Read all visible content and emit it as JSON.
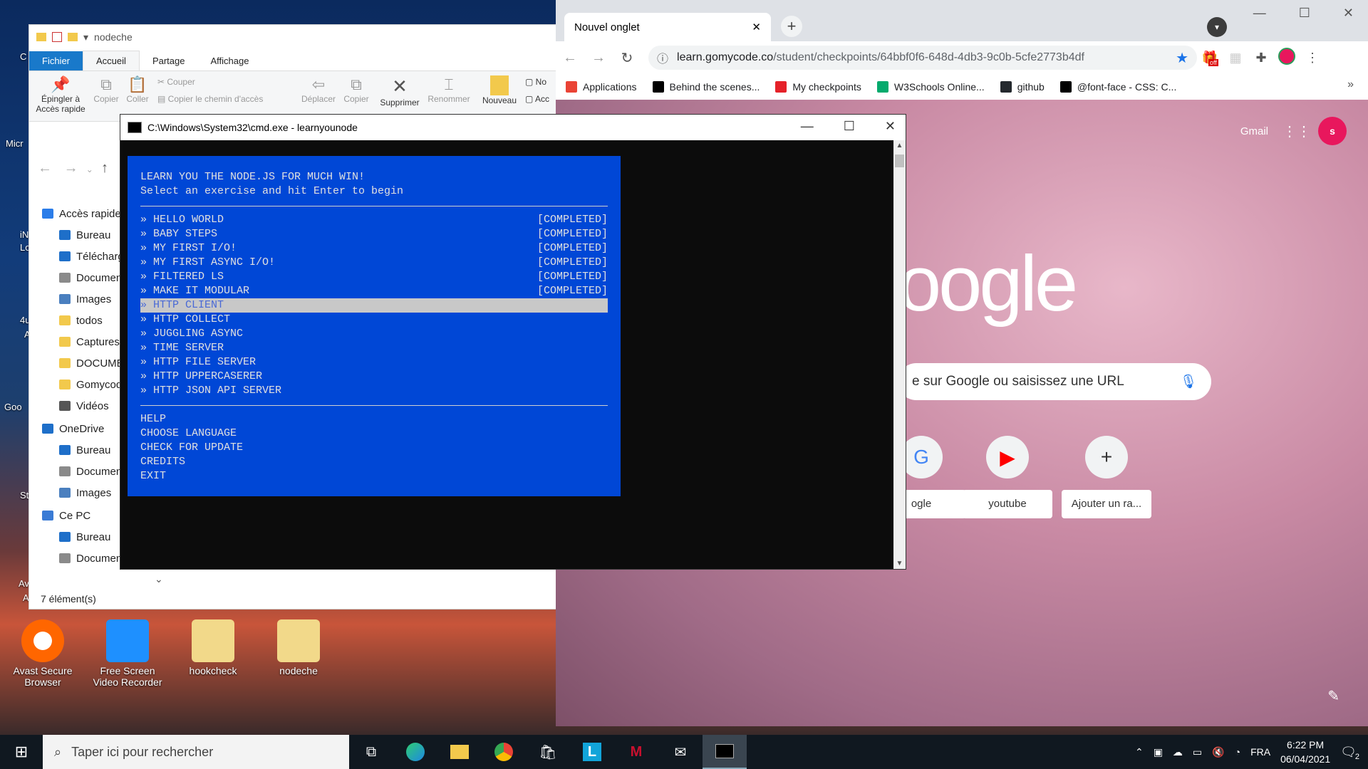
{
  "desktop": {
    "icons": [
      {
        "label": "Avast Secure Browser"
      },
      {
        "label": "Free Screen Video Recorder"
      },
      {
        "label": "hookcheck"
      },
      {
        "label": "nodeche"
      }
    ],
    "edge_labels": [
      "C",
      "Micr",
      "iN",
      "Lo",
      "4u",
      "A",
      "Goo",
      "St",
      "Av",
      "A"
    ]
  },
  "explorer": {
    "title": "nodeche",
    "tabs": [
      "Fichier",
      "Accueil",
      "Partage",
      "Affichage"
    ],
    "ribbon": {
      "pin_label": "Épingler à Accès rapide",
      "copy": "Copier",
      "paste": "Coller",
      "cut": "Couper",
      "copy_path": "Copier le chemin d'accès",
      "move": "Déplacer",
      "copy_to": "Copier",
      "delete": "Supprimer",
      "rename": "Renommer",
      "new": "Nouveau",
      "new_item_short": "No",
      "easy_access_short": "Acc"
    },
    "nav": [
      {
        "label": "Accès rapide",
        "level": 0,
        "icon": "star-icon",
        "color": "#2b7de9"
      },
      {
        "label": "Bureau",
        "level": 1,
        "icon": "desktop-icon",
        "color": "#1e6fc9"
      },
      {
        "label": "Téléchargements",
        "level": 1,
        "icon": "download-icon",
        "color": "#1e6fc9"
      },
      {
        "label": "Documents",
        "level": 1,
        "icon": "document-icon",
        "color": "#8a8a8a"
      },
      {
        "label": "Images",
        "level": 1,
        "icon": "images-icon",
        "color": "#4a7fbf"
      },
      {
        "label": "todos",
        "level": 1,
        "icon": "folder-icon",
        "color": "#f2c94c"
      },
      {
        "label": "Captures",
        "level": 1,
        "icon": "folder-icon",
        "color": "#f2c94c"
      },
      {
        "label": "DOCUMENTS",
        "level": 1,
        "icon": "folder-icon",
        "color": "#f2c94c"
      },
      {
        "label": "Gomycode",
        "level": 1,
        "icon": "folder-icon",
        "color": "#f2c94c"
      },
      {
        "label": "Vidéos",
        "level": 1,
        "icon": "video-icon",
        "color": "#555555"
      },
      {
        "label": "OneDrive",
        "level": 0,
        "icon": "cloud-icon",
        "color": "#1e6fc9"
      },
      {
        "label": "Bureau",
        "level": 1,
        "icon": "desktop-icon",
        "color": "#1e6fc9"
      },
      {
        "label": "Documents",
        "level": 1,
        "icon": "document-icon",
        "color": "#8a8a8a"
      },
      {
        "label": "Images",
        "level": 1,
        "icon": "images-icon",
        "color": "#4a7fbf"
      },
      {
        "label": "Ce PC",
        "level": 0,
        "icon": "computer-icon",
        "color": "#3a7bd5"
      },
      {
        "label": "Bureau",
        "level": 1,
        "icon": "desktop-icon",
        "color": "#1e6fc9"
      },
      {
        "label": "Documents",
        "level": 1,
        "icon": "document-icon",
        "color": "#8a8a8a"
      }
    ],
    "status": "7 élément(s)"
  },
  "chrome": {
    "tab_title": "Nouvel onglet",
    "url_host": "learn.gomycode.co",
    "url_path": "/student/checkpoints/64bbf0f6-648d-4db3-9c0b-5cfe2773b4df",
    "bookmarks": [
      {
        "label": "Applications",
        "icon": "apps-icon",
        "color": "#ea4335"
      },
      {
        "label": "Behind the scenes...",
        "icon": "dev-icon",
        "color": "#000000"
      },
      {
        "label": "My checkpoints",
        "icon": "gomycode-icon",
        "color": "#e52129"
      },
      {
        "label": "W3Schools Online...",
        "icon": "w3schools-icon",
        "color": "#04aa6d"
      },
      {
        "label": "github",
        "icon": "github-icon",
        "color": "#24292e"
      },
      {
        "label": "@font-face - CSS: C...",
        "icon": "mdn-icon",
        "color": "#000000"
      }
    ],
    "gmail": "Gmail",
    "profile_initial": "s",
    "logo_text": "oogle",
    "search_placeholder": "e sur Google ou saisissez une URL",
    "shortcuts": [
      {
        "label": "ogle",
        "glyph": "G"
      },
      {
        "label": "youtube",
        "glyph": "▶"
      },
      {
        "label": "Ajouter un ra...",
        "glyph": "+"
      }
    ],
    "ext_badge": "off"
  },
  "cmd": {
    "title": "C:\\Windows\\System32\\cmd.exe - learnyounode",
    "header_line1": "LEARN YOU THE NODE.JS FOR MUCH WIN!",
    "header_line2": "Select an exercise and hit Enter to begin",
    "exercises": [
      {
        "name": "» HELLO WORLD",
        "status": "[COMPLETED]",
        "selected": false
      },
      {
        "name": "» BABY STEPS",
        "status": "[COMPLETED]",
        "selected": false
      },
      {
        "name": "» MY FIRST I/O!",
        "status": "[COMPLETED]",
        "selected": false
      },
      {
        "name": "» MY FIRST ASYNC I/O!",
        "status": "[COMPLETED]",
        "selected": false
      },
      {
        "name": "» FILTERED LS",
        "status": "[COMPLETED]",
        "selected": false
      },
      {
        "name": "» MAKE IT MODULAR",
        "status": "[COMPLETED]",
        "selected": false
      },
      {
        "name": "» HTTP CLIENT",
        "status": "",
        "selected": true
      },
      {
        "name": "» HTTP COLLECT",
        "status": "",
        "selected": false
      },
      {
        "name": "» JUGGLING ASYNC",
        "status": "",
        "selected": false
      },
      {
        "name": "» TIME SERVER",
        "status": "",
        "selected": false
      },
      {
        "name": "» HTTP FILE SERVER",
        "status": "",
        "selected": false
      },
      {
        "name": "» HTTP UPPERCASERER",
        "status": "",
        "selected": false
      },
      {
        "name": "» HTTP JSON API SERVER",
        "status": "",
        "selected": false
      }
    ],
    "menu": [
      "HELP",
      "CHOOSE LANGUAGE",
      "CHECK FOR UPDATE",
      "CREDITS",
      "EXIT"
    ]
  },
  "taskbar": {
    "search_placeholder": "Taper ici pour rechercher",
    "language": "FRA",
    "time": "6:22 PM",
    "date": "06/04/2021",
    "notification_count": "2"
  }
}
